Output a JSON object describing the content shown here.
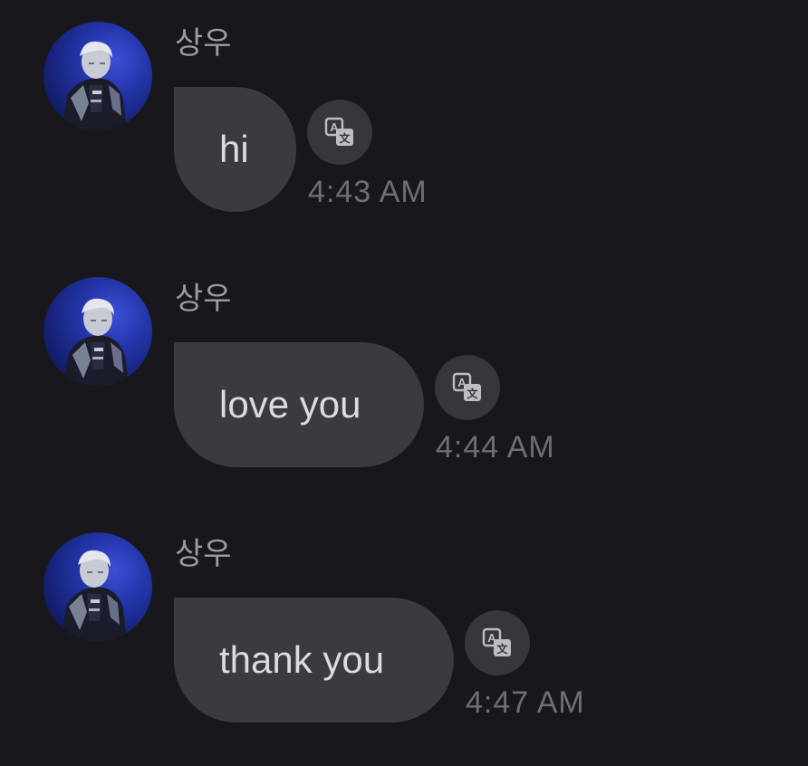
{
  "chat": {
    "messages": [
      {
        "sender": "상우",
        "text": "hi",
        "time": "4:43 AM",
        "avatar_icon": "profile-photo",
        "translate_icon": "translate-icon"
      },
      {
        "sender": "상우",
        "text": "love you",
        "time": "4:44 AM",
        "avatar_icon": "profile-photo",
        "translate_icon": "translate-icon"
      },
      {
        "sender": "상우",
        "text": "thank you",
        "time": "4:47 AM",
        "avatar_icon": "profile-photo",
        "translate_icon": "translate-icon"
      }
    ]
  },
  "colors": {
    "background": "#18181c",
    "bubble": "#3a3a3f",
    "bubble_text": "#dcdce0",
    "sender_name": "#9b9ba3",
    "timestamp": "#6e6e76",
    "avatar_accent": "#2334a8"
  }
}
